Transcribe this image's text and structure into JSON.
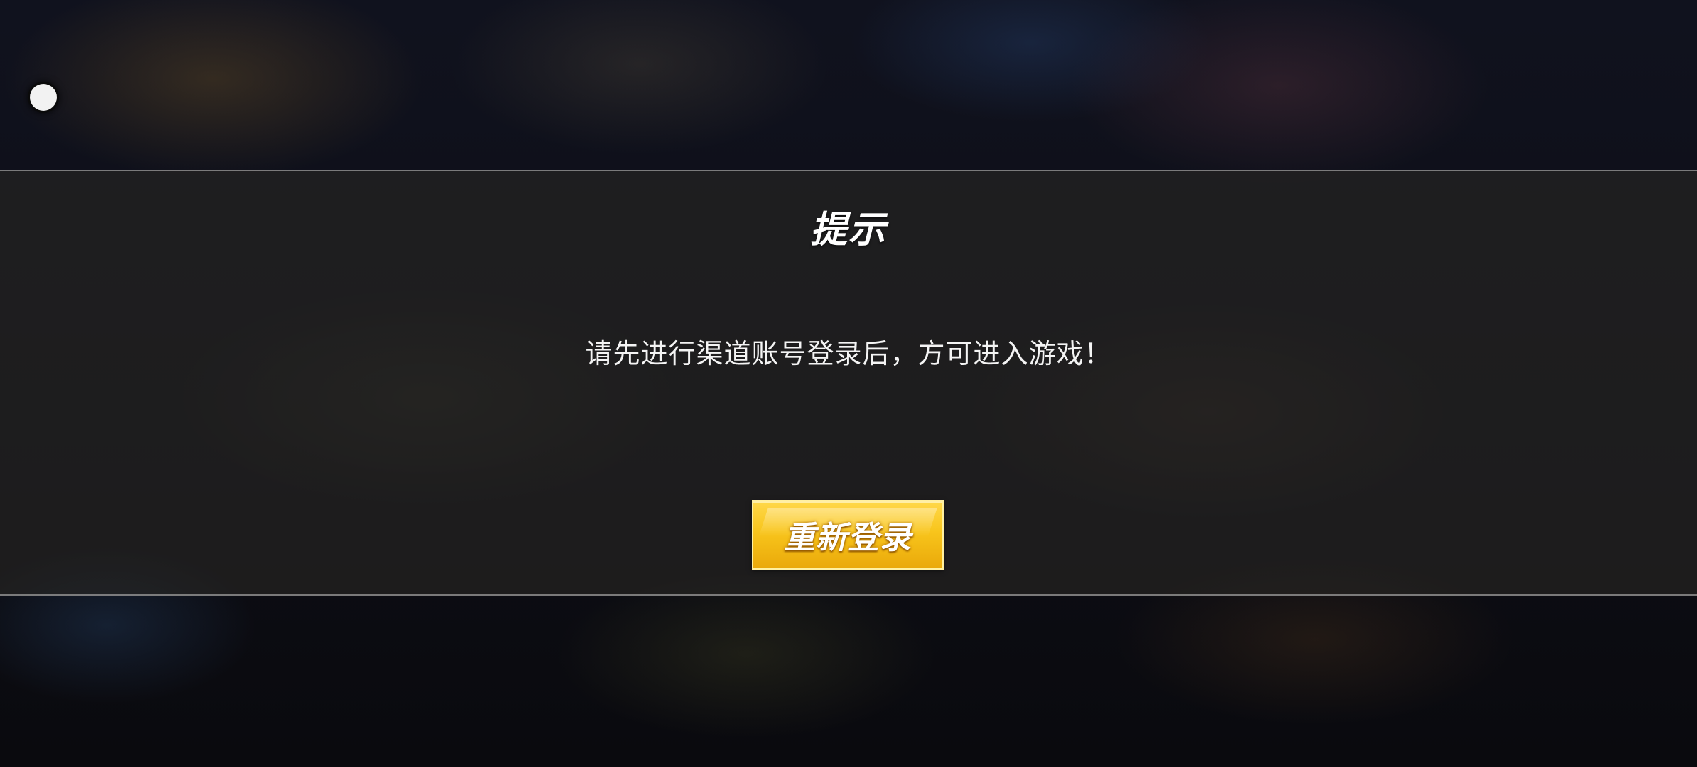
{
  "float_ball": {
    "icon": "assistive-touch-icon"
  },
  "dialog": {
    "title": "提示",
    "message": "请先进行渠道账号登录后，方可进入游戏！",
    "relogin_label": "重新登录"
  },
  "colors": {
    "button_yellow": "#f8c51c",
    "panel": "#282624",
    "text": "#ffffff"
  }
}
